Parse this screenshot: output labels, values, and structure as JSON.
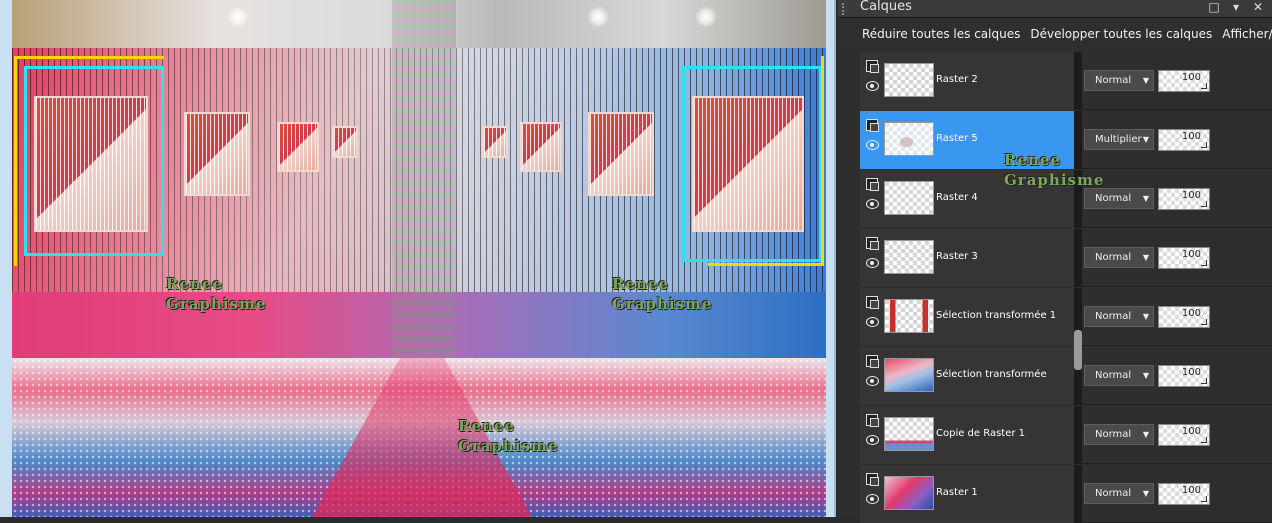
{
  "panel": {
    "title": "Calques",
    "header_buttons": [
      "□",
      "▾",
      "✕"
    ],
    "toolbar": {
      "collapse_all": "Réduire toutes les calques",
      "expand_all": "Développer toutes les calques",
      "show_hide": "Afficher/Masquer"
    },
    "layers": [
      {
        "name": "Raster 2",
        "blend": "Normal",
        "opacity": "100",
        "selected": false,
        "thumb": "transparent"
      },
      {
        "name": "Raster 5",
        "blend": "Multiplier",
        "opacity": "100",
        "selected": true,
        "thumb": "r5"
      },
      {
        "name": "Raster 4",
        "blend": "Normal",
        "opacity": "100",
        "selected": false,
        "thumb": "transparent"
      },
      {
        "name": "Raster 3",
        "blend": "Normal",
        "opacity": "100",
        "selected": false,
        "thumb": "transparent"
      },
      {
        "name": "Sélection transformée 1",
        "blend": "Normal",
        "opacity": "100",
        "selected": false,
        "thumb": "sel1"
      },
      {
        "name": "Sélection transformée",
        "blend": "Normal",
        "opacity": "100",
        "selected": false,
        "thumb": "sel"
      },
      {
        "name": "Copie de Raster 1",
        "blend": "Normal",
        "opacity": "100",
        "selected": false,
        "thumb": "copy"
      },
      {
        "name": "Raster 1",
        "blend": "Normal",
        "opacity": "100",
        "selected": false,
        "thumb": "r1"
      }
    ]
  },
  "canvas": {
    "watermark_line1": "Renee",
    "watermark_line2": "Graphisme"
  },
  "colors": {
    "selection": "#3997f0",
    "neon_cyan": "#29e3f2",
    "neon_yellow": "#ffd400"
  }
}
